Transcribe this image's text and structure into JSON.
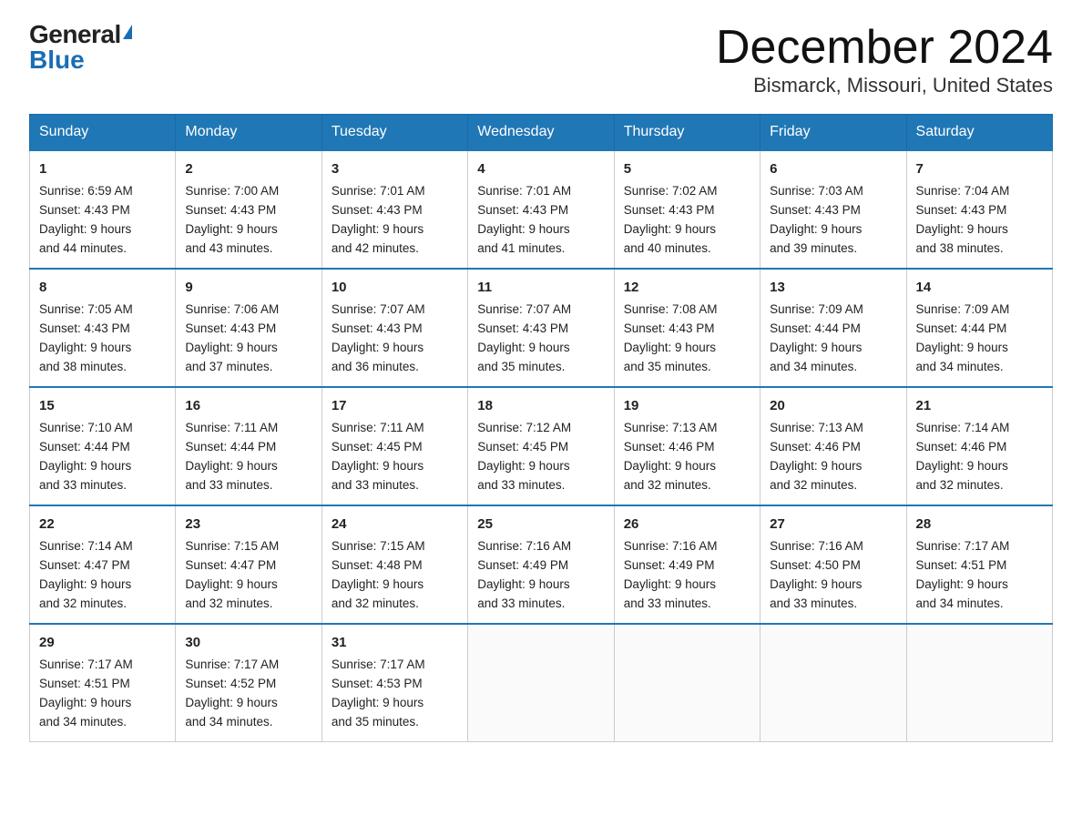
{
  "logo": {
    "general": "General",
    "blue": "Blue"
  },
  "title": "December 2024",
  "subtitle": "Bismarck, Missouri, United States",
  "weekdays": [
    "Sunday",
    "Monday",
    "Tuesday",
    "Wednesday",
    "Thursday",
    "Friday",
    "Saturday"
  ],
  "weeks": [
    [
      {
        "day": "1",
        "sunrise": "6:59 AM",
        "sunset": "4:43 PM",
        "daylight": "9 hours and 44 minutes."
      },
      {
        "day": "2",
        "sunrise": "7:00 AM",
        "sunset": "4:43 PM",
        "daylight": "9 hours and 43 minutes."
      },
      {
        "day": "3",
        "sunrise": "7:01 AM",
        "sunset": "4:43 PM",
        "daylight": "9 hours and 42 minutes."
      },
      {
        "day": "4",
        "sunrise": "7:01 AM",
        "sunset": "4:43 PM",
        "daylight": "9 hours and 41 minutes."
      },
      {
        "day": "5",
        "sunrise": "7:02 AM",
        "sunset": "4:43 PM",
        "daylight": "9 hours and 40 minutes."
      },
      {
        "day": "6",
        "sunrise": "7:03 AM",
        "sunset": "4:43 PM",
        "daylight": "9 hours and 39 minutes."
      },
      {
        "day": "7",
        "sunrise": "7:04 AM",
        "sunset": "4:43 PM",
        "daylight": "9 hours and 38 minutes."
      }
    ],
    [
      {
        "day": "8",
        "sunrise": "7:05 AM",
        "sunset": "4:43 PM",
        "daylight": "9 hours and 38 minutes."
      },
      {
        "day": "9",
        "sunrise": "7:06 AM",
        "sunset": "4:43 PM",
        "daylight": "9 hours and 37 minutes."
      },
      {
        "day": "10",
        "sunrise": "7:07 AM",
        "sunset": "4:43 PM",
        "daylight": "9 hours and 36 minutes."
      },
      {
        "day": "11",
        "sunrise": "7:07 AM",
        "sunset": "4:43 PM",
        "daylight": "9 hours and 35 minutes."
      },
      {
        "day": "12",
        "sunrise": "7:08 AM",
        "sunset": "4:43 PM",
        "daylight": "9 hours and 35 minutes."
      },
      {
        "day": "13",
        "sunrise": "7:09 AM",
        "sunset": "4:44 PM",
        "daylight": "9 hours and 34 minutes."
      },
      {
        "day": "14",
        "sunrise": "7:09 AM",
        "sunset": "4:44 PM",
        "daylight": "9 hours and 34 minutes."
      }
    ],
    [
      {
        "day": "15",
        "sunrise": "7:10 AM",
        "sunset": "4:44 PM",
        "daylight": "9 hours and 33 minutes."
      },
      {
        "day": "16",
        "sunrise": "7:11 AM",
        "sunset": "4:44 PM",
        "daylight": "9 hours and 33 minutes."
      },
      {
        "day": "17",
        "sunrise": "7:11 AM",
        "sunset": "4:45 PM",
        "daylight": "9 hours and 33 minutes."
      },
      {
        "day": "18",
        "sunrise": "7:12 AM",
        "sunset": "4:45 PM",
        "daylight": "9 hours and 33 minutes."
      },
      {
        "day": "19",
        "sunrise": "7:13 AM",
        "sunset": "4:46 PM",
        "daylight": "9 hours and 32 minutes."
      },
      {
        "day": "20",
        "sunrise": "7:13 AM",
        "sunset": "4:46 PM",
        "daylight": "9 hours and 32 minutes."
      },
      {
        "day": "21",
        "sunrise": "7:14 AM",
        "sunset": "4:46 PM",
        "daylight": "9 hours and 32 minutes."
      }
    ],
    [
      {
        "day": "22",
        "sunrise": "7:14 AM",
        "sunset": "4:47 PM",
        "daylight": "9 hours and 32 minutes."
      },
      {
        "day": "23",
        "sunrise": "7:15 AM",
        "sunset": "4:47 PM",
        "daylight": "9 hours and 32 minutes."
      },
      {
        "day": "24",
        "sunrise": "7:15 AM",
        "sunset": "4:48 PM",
        "daylight": "9 hours and 32 minutes."
      },
      {
        "day": "25",
        "sunrise": "7:16 AM",
        "sunset": "4:49 PM",
        "daylight": "9 hours and 33 minutes."
      },
      {
        "day": "26",
        "sunrise": "7:16 AM",
        "sunset": "4:49 PM",
        "daylight": "9 hours and 33 minutes."
      },
      {
        "day": "27",
        "sunrise": "7:16 AM",
        "sunset": "4:50 PM",
        "daylight": "9 hours and 33 minutes."
      },
      {
        "day": "28",
        "sunrise": "7:17 AM",
        "sunset": "4:51 PM",
        "daylight": "9 hours and 34 minutes."
      }
    ],
    [
      {
        "day": "29",
        "sunrise": "7:17 AM",
        "sunset": "4:51 PM",
        "daylight": "9 hours and 34 minutes."
      },
      {
        "day": "30",
        "sunrise": "7:17 AM",
        "sunset": "4:52 PM",
        "daylight": "9 hours and 34 minutes."
      },
      {
        "day": "31",
        "sunrise": "7:17 AM",
        "sunset": "4:53 PM",
        "daylight": "9 hours and 35 minutes."
      },
      null,
      null,
      null,
      null
    ]
  ]
}
